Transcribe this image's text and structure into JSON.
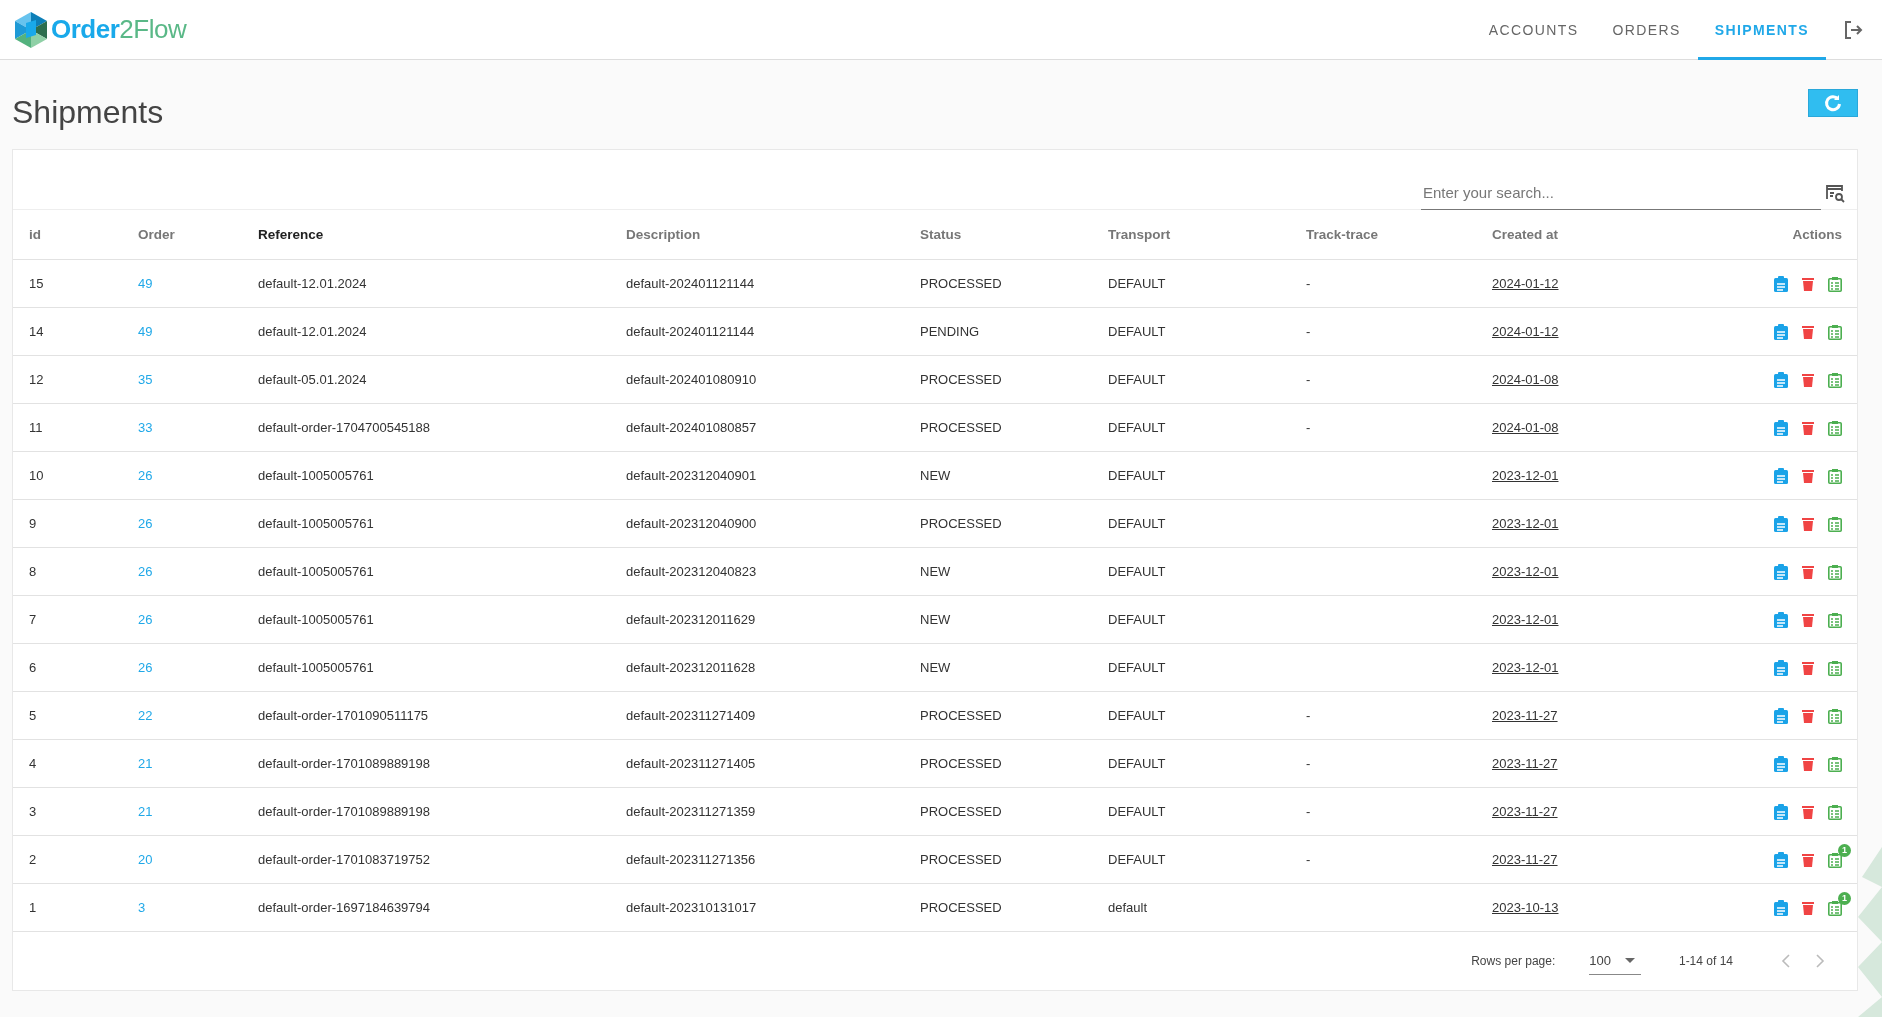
{
  "header": {
    "logo": "**Order**2Flow",
    "nav": [
      {
        "label": "ACCOUNTS",
        "selected": false
      },
      {
        "label": "ORDERS",
        "selected": false
      },
      {
        "label": "SHIPMENTS",
        "selected": true
      }
    ]
  },
  "page": {
    "title": "Shipments"
  },
  "search": {
    "placeholder": "Enter your search..."
  },
  "table": {
    "columns": [
      {
        "label": "id",
        "sorted": false
      },
      {
        "label": "Order",
        "sorted": false
      },
      {
        "label": "Reference",
        "sorted": true
      },
      {
        "label": "Description",
        "sorted": false
      },
      {
        "label": "Status",
        "sorted": false
      },
      {
        "label": "Transport",
        "sorted": false
      },
      {
        "label": "Track-trace",
        "sorted": false
      },
      {
        "label": "Created at",
        "sorted": false
      },
      {
        "label": "Actions",
        "sorted": false
      }
    ],
    "rows": [
      {
        "id": "15",
        "order": "49",
        "reference": "default-12.01.2024",
        "description": "default-202401121144",
        "status": "PROCESSED",
        "transport": "DEFAULT",
        "track_trace": "-",
        "created_at": "2024-01-12"
      },
      {
        "id": "14",
        "order": "49",
        "reference": "default-12.01.2024",
        "description": "default-202401121144",
        "status": "PENDING",
        "transport": "DEFAULT",
        "track_trace": "-",
        "created_at": "2024-01-12"
      },
      {
        "id": "12",
        "order": "35",
        "reference": "default-05.01.2024",
        "description": "default-202401080910",
        "status": "PROCESSED",
        "transport": "DEFAULT",
        "track_trace": "-",
        "created_at": "2024-01-08"
      },
      {
        "id": "11",
        "order": "33",
        "reference": "default-order-1704700545188",
        "description": "default-202401080857",
        "status": "PROCESSED",
        "transport": "DEFAULT",
        "track_trace": "-",
        "created_at": "2024-01-08"
      },
      {
        "id": "10",
        "order": "26",
        "reference": "default-1005005761",
        "description": "default-202312040901",
        "status": "NEW",
        "transport": "DEFAULT",
        "created_at": "2023-12-01"
      },
      {
        "id": "9",
        "order": "26",
        "reference": "default-1005005761",
        "description": "default-202312040900",
        "status": "PROCESSED",
        "transport": "DEFAULT",
        "created_at": "2023-12-01"
      },
      {
        "id": "8",
        "order": "26",
        "reference": "default-1005005761",
        "description": "default-202312040823",
        "status": "NEW",
        "transport": "DEFAULT",
        "created_at": "2023-12-01"
      },
      {
        "id": "7",
        "order": "26",
        "reference": "default-1005005761",
        "description": "default-202312011629",
        "status": "NEW",
        "transport": "DEFAULT",
        "created_at": "2023-12-01"
      },
      {
        "id": "6",
        "order": "26",
        "reference": "default-1005005761",
        "description": "default-202312011628",
        "status": "NEW",
        "transport": "DEFAULT",
        "created_at": "2023-12-01"
      },
      {
        "id": "5",
        "order": "22",
        "reference": "default-order-1701090511175",
        "description": "default-202311271409",
        "status": "PROCESSED",
        "transport": "DEFAULT",
        "track_trace": "-",
        "created_at": "2023-11-27"
      },
      {
        "id": "4",
        "order": "21",
        "reference": "default-order-1701089889198",
        "description": "default-202311271405",
        "status": "PROCESSED",
        "transport": "DEFAULT",
        "track_trace": "-",
        "created_at": "2023-11-27"
      },
      {
        "id": "3",
        "order": "21",
        "reference": "default-order-1701089889198",
        "description": "default-202311271359",
        "status": "PROCESSED",
        "transport": "DEFAULT",
        "track_trace": "-",
        "created_at": "2023-11-27"
      },
      {
        "id": "2",
        "order": "20",
        "reference": "default-order-1701083719752",
        "description": "default-202311271356",
        "status": "PROCESSED",
        "transport": "DEFAULT",
        "track_trace": "-",
        "created_at": "2023-11-27",
        "badge": "1"
      },
      {
        "id": "1",
        "order": "3",
        "reference": "default-order-1697184639794",
        "description": "default-202310131017",
        "status": "PROCESSED",
        "transport": "default",
        "created_at": "2023-10-13",
        "badge": "1"
      }
    ]
  },
  "pagination": {
    "rows_per_page_label": "Rows per page:",
    "rows_per_page": "100",
    "range": "1-14 of 14"
  }
}
